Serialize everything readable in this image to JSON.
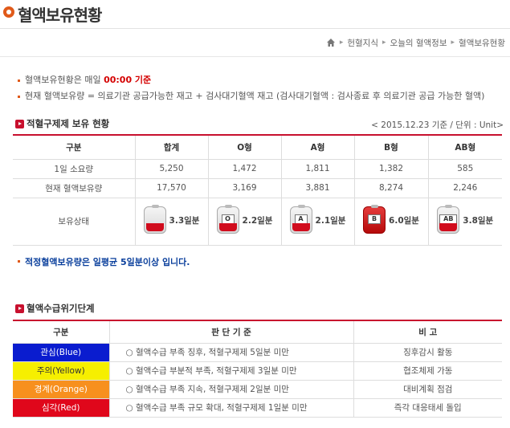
{
  "page": {
    "title": "혈액보유현황"
  },
  "breadcrumb": {
    "items": [
      "헌혈지식",
      "오늘의 혈액정보",
      "혈액보유현황"
    ]
  },
  "notes": {
    "n1_prefix": "혈액보유현황은 매일 ",
    "n1_highlight": "00:00 기준",
    "n2": "현재 혈액보유량 = 의료기관 공급가능한 재고 + 검사대기혈액 재고 (검사대기혈액 : 검사종료 후 의료기관 공급 가능한 혈액)"
  },
  "section1": {
    "title": "적혈구제제 보유 현황",
    "date_note": "< 2015.12.23 기준 / 단위 : Unit>"
  },
  "holdings_table": {
    "headers": [
      "구분",
      "합계",
      "O형",
      "A형",
      "B형",
      "AB형"
    ],
    "rows": [
      {
        "label": "1일 소요량",
        "values": [
          "5,250",
          "1,472",
          "1,811",
          "1,382",
          "585"
        ]
      },
      {
        "label": "현재 혈액보유량",
        "values": [
          "17,570",
          "3,169",
          "3,881",
          "8,274",
          "2,246"
        ]
      }
    ],
    "status_label": "보유상태",
    "status": [
      {
        "tag": "",
        "days": "3.3일분",
        "color": "#d10c1d"
      },
      {
        "tag": "O",
        "days": "2.2일분",
        "color": "#d10c1d"
      },
      {
        "tag": "A",
        "days": "2.1일분",
        "color": "#d10c1d"
      },
      {
        "tag": "B",
        "days": "6.0일분",
        "color": "#d10c1d"
      },
      {
        "tag": "AB",
        "days": "3.8일분",
        "color": "#d10c1d"
      }
    ]
  },
  "advisory": "적정혈액보유량은 일평균 5일분이상 입니다.",
  "section2": {
    "title": "혈액수급위기단계"
  },
  "crisis_table": {
    "headers": [
      "구분",
      "판 단 기 준",
      "비 고"
    ],
    "rows": [
      {
        "level": "관심(Blue)",
        "bg": "#0a1ccf",
        "fg": "#ffffff",
        "criteria": "○ 혈액수급 부족 징후, 적혈구제제 5일분 미만",
        "note": "징후감시 활동"
      },
      {
        "level": "주의(Yellow)",
        "bg": "#f6ef00",
        "fg": "#333333",
        "criteria": "○ 혈액수급 부분적 부족, 적혈구제제 3일분 미만",
        "note": "협조체제 가동"
      },
      {
        "level": "경계(Orange)",
        "bg": "#f7901e",
        "fg": "#ffffff",
        "criteria": "○ 혈액수급 부족 지속, 적혈구제제 2일분 미만",
        "note": "대비계획 점검"
      },
      {
        "level": "심각(Red)",
        "bg": "#e0071b",
        "fg": "#ffffff",
        "criteria": "○ 혈액수급 부족 규모 확대, 적혈구제제 1일분 미만",
        "note": "즉각 대응태세 돌입"
      }
    ]
  }
}
